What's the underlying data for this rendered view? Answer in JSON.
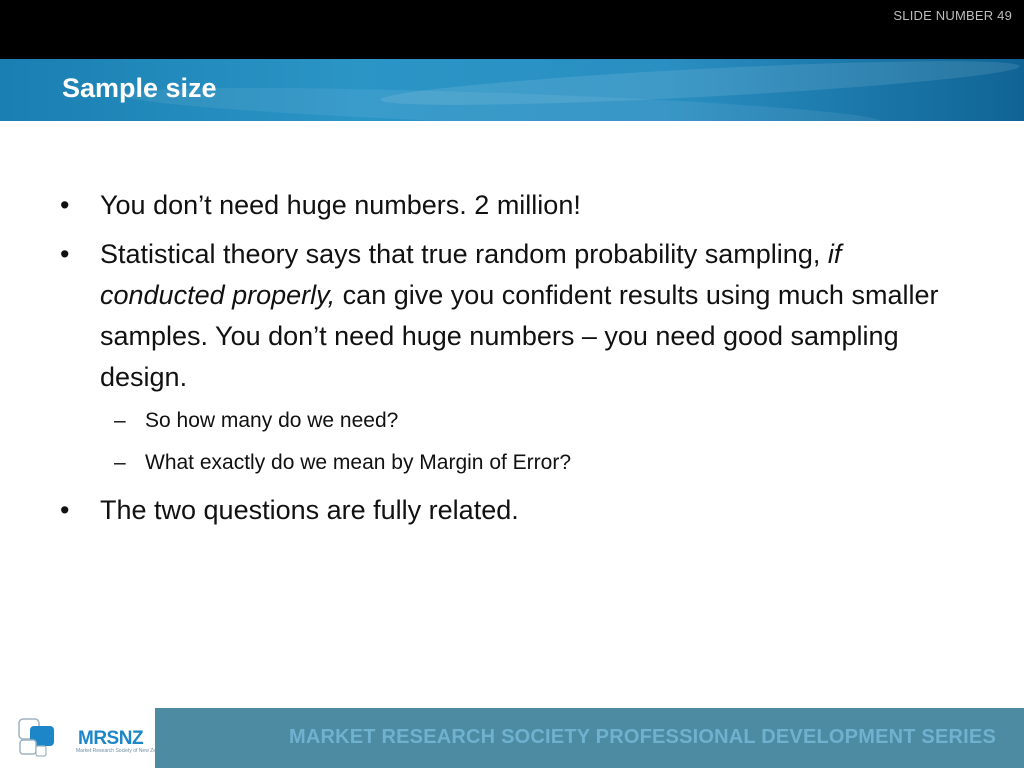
{
  "header": {
    "slide_number": "SLIDE NUMBER 49"
  },
  "slide": {
    "title": "Sample size",
    "bullets": [
      {
        "text": "You don’t need huge numbers. 2 million!"
      },
      {
        "text_pre": "Statistical theory says that true random probability sampling,",
        "text_italic": "if conducted properly,",
        "text_post": "can give you confident results using much smaller samples. You don’t need huge numbers – you need good sampling design."
      },
      {
        "text": "The two questions are fully related."
      }
    ],
    "subbullets": [
      "So how many do we need?",
      "What exactly do we mean by Margin of Error?"
    ],
    "bullet_glyph": "•",
    "dash_glyph": "–"
  },
  "footer": {
    "logo_text": "MRSNZ",
    "logo_tagline": "Market Research Society of New Zealand",
    "series_text": "MARKET RESEARCH SOCIETY PROFESSIONAL DEVELOPMENT SERIES"
  },
  "colors": {
    "title_bar": "#2a8fc2",
    "footer_band": "#4d8ba3",
    "footer_text": "#6fb1ce",
    "logo_blue": "#1c86c8"
  }
}
